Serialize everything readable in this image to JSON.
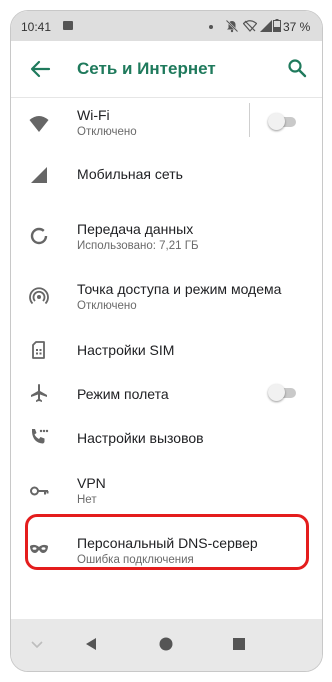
{
  "status_bar": {
    "time": "10:41",
    "battery": "37 %",
    "icons": [
      "image-icon",
      "dot-icon",
      "bell-off-icon",
      "wifi-off-icon",
      "signal-icon",
      "battery-icon"
    ]
  },
  "app_bar": {
    "title": "Сеть и Интернет",
    "accent_color": "#1f7a5c"
  },
  "settings": {
    "items": [
      {
        "title": "Wi-Fi",
        "subtitle": "Отключено",
        "icon": "wifi-icon",
        "toggle": "off"
      },
      {
        "title": "Мобильная сеть",
        "icon": "cellular-icon"
      },
      {
        "title": "Передача данных",
        "subtitle": "Использовано: 7,21 ГБ",
        "icon": "data-usage-icon"
      },
      {
        "title": "Точка доступа и режим модема",
        "subtitle": "Отключено",
        "icon": "hotspot-icon"
      },
      {
        "title": "Настройки SIM",
        "icon": "sim-card-icon"
      },
      {
        "title": "Режим полета",
        "icon": "airplane-icon",
        "toggle": "off"
      },
      {
        "title": "Настройки вызовов",
        "icon": "call-settings-icon"
      },
      {
        "title": "VPN",
        "subtitle": "Нет",
        "icon": "vpn-key-icon"
      },
      {
        "title": "Персональный DNS-сервер",
        "subtitle": "Ошибка подключения",
        "icon": "private-dns-icon",
        "highlighted": true
      }
    ]
  },
  "highlight_color": "#e41d1d",
  "nav_bar": {
    "icons": [
      "chevron-down-icon",
      "back-triangle-icon",
      "home-circle-icon",
      "recents-square-icon"
    ]
  }
}
